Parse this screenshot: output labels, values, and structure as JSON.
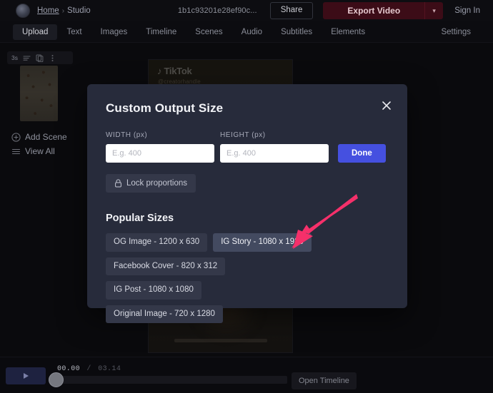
{
  "topbar": {
    "breadcrumb_home": "Home",
    "breadcrumb_separator": "›",
    "breadcrumb_current": "Studio",
    "project_id": "1b1c93201e28ef90c...",
    "share_label": "Share",
    "export_label": "Export Video",
    "export_caret": "▾",
    "signin_label": "Sign In",
    "export_color": "#3c0c17"
  },
  "nav": {
    "tabs": [
      {
        "label": "Upload",
        "active": true
      },
      {
        "label": "Text",
        "active": false
      },
      {
        "label": "Images",
        "active": false
      },
      {
        "label": "Timeline",
        "active": false
      },
      {
        "label": "Scenes",
        "active": false
      },
      {
        "label": "Audio",
        "active": false
      },
      {
        "label": "Subtitles",
        "active": false
      },
      {
        "label": "Elements",
        "active": false
      }
    ],
    "settings_label": "Settings"
  },
  "scene_panel": {
    "scene_duration": "3s",
    "icons": [
      "list-icon",
      "duplicate-icon",
      "more-icon"
    ],
    "add_scene_label": "Add Scene",
    "view_all_label": "View All"
  },
  "preview": {
    "watermark": "TikTok",
    "watermark_note": "♪",
    "username": "@creatorhandle"
  },
  "modal": {
    "title": "Custom Output Size",
    "close_icon": "close-icon",
    "width_label": "WIDTH (px)",
    "width_value": "",
    "width_placeholder": "E.g. 400",
    "height_label": "HEIGHT (px)",
    "height_value": "",
    "height_placeholder": "E.g. 400",
    "done_label": "Done",
    "done_color": "#4550e0",
    "lock_label": "Lock proportions",
    "popular_title": "Popular Sizes",
    "background_color": "#272b3b",
    "popular_sizes": [
      {
        "label": "OG Image - 1200 x 630",
        "hovered": false
      },
      {
        "label": "IG Story - 1080 x 1920",
        "hovered": true
      },
      {
        "label": "Facebook Cover - 820 x 312",
        "hovered": false
      },
      {
        "label": "IG Post - 1080 x 1080",
        "hovered": false
      },
      {
        "label": "Original Image - 720 x 1280",
        "hovered": false
      }
    ]
  },
  "annotation": {
    "type": "arrow",
    "color": "#f5306a",
    "points_at": "IG Story - 1080 x 1920",
    "direction": "down-left"
  },
  "player": {
    "play_icon": "play-icon",
    "current_time": "00.00",
    "time_separator": "/",
    "total_time": "03.14",
    "progress_percent": 0,
    "open_timeline_label": "Open Timeline"
  }
}
